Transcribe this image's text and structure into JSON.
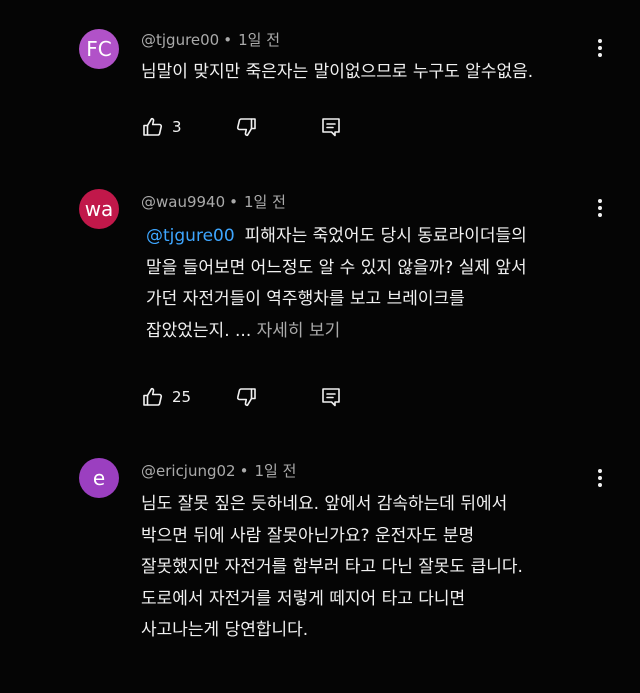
{
  "comments": [
    {
      "avatar_initials": "FC",
      "avatar_color": "#b152c8",
      "username": "@tjgure00",
      "time": "1일 전",
      "mention": "",
      "text_lines": [
        "님말이 맞지만 죽은자는 말이없으므로 누구도 알수없음."
      ],
      "more_label": "",
      "like_count": "3"
    },
    {
      "avatar_initials": "wa",
      "avatar_color": "#c1184a",
      "username": "@wau9940",
      "time": "1일 전",
      "mention": "@tjgure00",
      "text_lines": [
        "피해자는 죽었어도 당시 동료라이더들의",
        "말을 들어보면 어느정도 알 수 있지 않을까? 실제 앞서",
        "가던 자전거들이 역주행차를 보고 브레이크를",
        "잡았었는지. ..."
      ],
      "more_label": "자세히 보기",
      "like_count": "25"
    },
    {
      "avatar_initials": "e",
      "avatar_color": "#9b3fc0",
      "username": "@ericjung02",
      "time": "1일 전",
      "mention": "",
      "text_lines": [
        "님도 잘못 짚은 듯하네요. 앞에서 감속하는데 뒤에서",
        "박으면 뒤에 사람 잘못아닌가요? 운전자도 분명",
        "잘못했지만 자전거를 함부러 타고 다닌 잘못도 큽니다.",
        "도로에서 자전거를 저렇게 떼지어 타고 다니면",
        "사고나는게 당연합니다."
      ],
      "more_label": "",
      "like_count": ""
    }
  ],
  "icons": {
    "like": "thumb-up-icon",
    "dislike": "thumb-down-icon",
    "reply": "reply-icon",
    "more": "more-vert-icon"
  },
  "colors": {
    "background": "#050505",
    "text": "#f1f1f1",
    "meta": "#aaaaaa",
    "mention": "#3ea6ff"
  }
}
